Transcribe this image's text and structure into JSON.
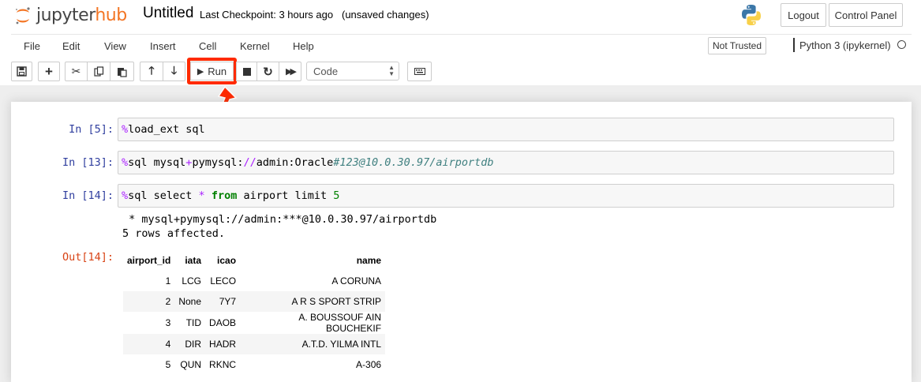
{
  "header": {
    "logo_text_1": "jupyter",
    "logo_text_2": "hub",
    "notebook_name": "Untitled",
    "checkpoint": "Last Checkpoint: 3 hours ago",
    "save_status": "(unsaved changes)",
    "logout_label": "Logout",
    "control_panel_label": "Control Panel"
  },
  "menu": {
    "items": [
      "File",
      "Edit",
      "View",
      "Insert",
      "Cell",
      "Kernel",
      "Help"
    ],
    "trust_label": "Not Trusted",
    "kernel_name": "Python 3 (ipykernel)"
  },
  "toolbar": {
    "run_label": "Run",
    "cell_type": "Code"
  },
  "cells": [
    {
      "prompt": "In [5]:",
      "source": "%load_ext sql"
    },
    {
      "prompt": "In [13]:",
      "source": "%sql mysql+pymysql://admin:Oracle#123@10.0.30.97/airportdb"
    },
    {
      "prompt": "In [14]:",
      "source": "%sql select * from airport limit 5"
    }
  ],
  "output": {
    "stdout_1": " * mysql+pymysql://admin:***@10.0.30.97/airportdb",
    "stdout_2": "5 rows affected.",
    "prompt": "Out[14]:",
    "table": {
      "columns": [
        "airport_id",
        "iata",
        "icao",
        "name"
      ],
      "rows": [
        [
          "1",
          "LCG",
          "LECO",
          "A CORUNA"
        ],
        [
          "2",
          "None",
          "7Y7",
          "A R S SPORT STRIP"
        ],
        [
          "3",
          "TID",
          "DAOB",
          "A. BOUSSOUF AIN BOUCHEKIF"
        ],
        [
          "4",
          "DIR",
          "HADR",
          "A.T.D. YILMA INTL"
        ],
        [
          "5",
          "QUN",
          "RKNC",
          "A-306"
        ]
      ]
    }
  },
  "colors": {
    "highlight": "#ff2a00",
    "brand_orange": "#f37524",
    "prompt_in": "#303f9f",
    "prompt_out": "#d84315"
  }
}
